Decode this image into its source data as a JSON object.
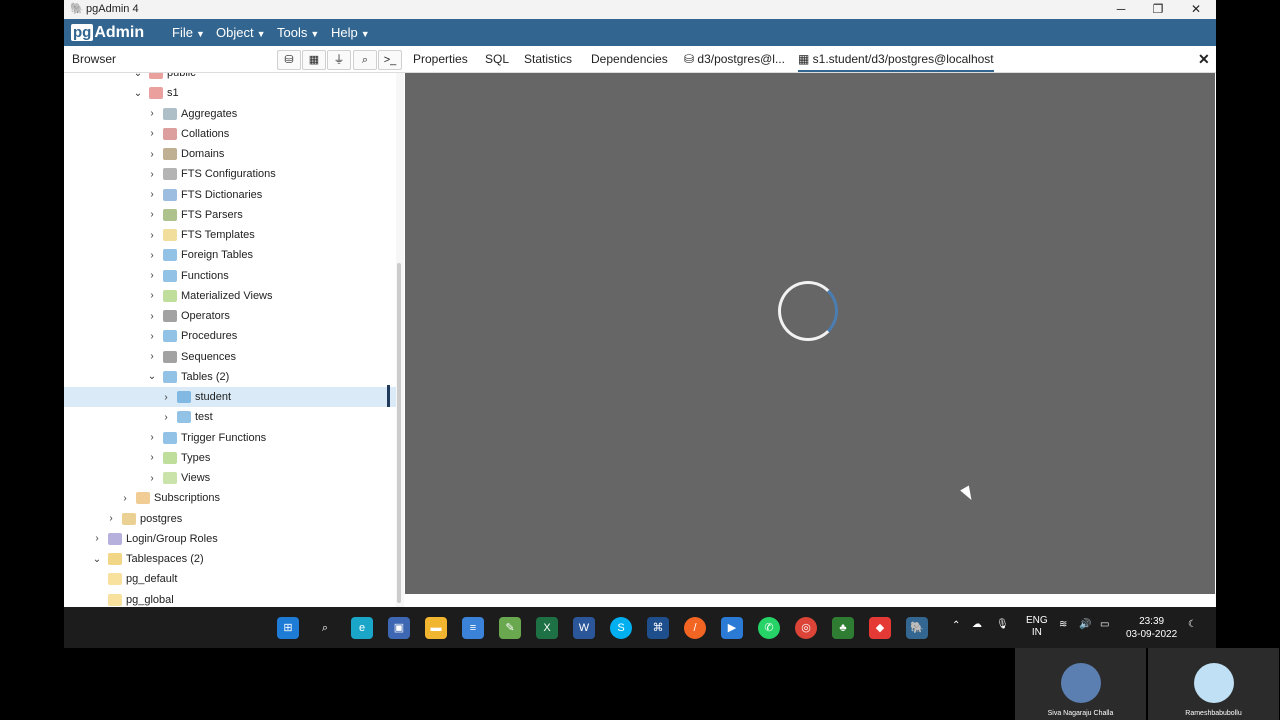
{
  "window": {
    "title": "pgAdmin 4",
    "controls": {
      "minimize": "─",
      "maximize": "❐",
      "close": "✕"
    }
  },
  "menubar": {
    "logo_pg": "pg",
    "logo_rest": "Admin",
    "items": [
      "File",
      "Object",
      "Tools",
      "Help"
    ]
  },
  "browser": {
    "label": "Browser",
    "toolbar_icons": [
      "database-icon",
      "table-icon",
      "filter-icon",
      "search-icon",
      "terminal-icon"
    ]
  },
  "tabs": {
    "items": [
      "Properties",
      "SQL",
      "Statistics",
      "Dependencies",
      "d3/postgres@l...",
      "s1.student/d3/postgres@localhost"
    ],
    "close": "✕"
  },
  "tree": [
    {
      "label": "public",
      "expanded": true,
      "icon": "schema-icon"
    },
    {
      "label": "s1",
      "expanded": true,
      "icon": "schema-icon"
    },
    {
      "label": "Aggregates",
      "icon": "aggregates-icon"
    },
    {
      "label": "Collations",
      "icon": "collations-icon"
    },
    {
      "label": "Domains",
      "icon": "domains-icon"
    },
    {
      "label": "FTS Configurations",
      "icon": "fts-config-icon"
    },
    {
      "label": "FTS Dictionaries",
      "icon": "fts-dict-icon"
    },
    {
      "label": "FTS Parsers",
      "icon": "fts-parser-icon"
    },
    {
      "label": "FTS Templates",
      "icon": "fts-template-icon"
    },
    {
      "label": "Foreign Tables",
      "icon": "foreign-table-icon"
    },
    {
      "label": "Functions",
      "icon": "function-icon"
    },
    {
      "label": "Materialized Views",
      "icon": "matview-icon"
    },
    {
      "label": "Operators",
      "icon": "operator-icon"
    },
    {
      "label": "Procedures",
      "icon": "procedure-icon"
    },
    {
      "label": "Sequences",
      "icon": "sequence-icon"
    },
    {
      "label": "Tables (2)",
      "expanded": true,
      "icon": "tables-icon"
    },
    {
      "label": "student",
      "selected": true,
      "icon": "table-icon"
    },
    {
      "label": "test",
      "icon": "table-icon"
    },
    {
      "label": "Trigger Functions",
      "icon": "trigger-function-icon"
    },
    {
      "label": "Types",
      "icon": "types-icon"
    },
    {
      "label": "Views",
      "icon": "views-icon"
    },
    {
      "label": "Subscriptions",
      "icon": "subscriptions-icon"
    },
    {
      "label": "postgres",
      "icon": "database-icon"
    },
    {
      "label": "Login/Group Roles",
      "icon": "roles-icon"
    },
    {
      "label": "Tablespaces (2)",
      "expanded": true,
      "icon": "tablespaces-icon"
    },
    {
      "label": "pg_default",
      "icon": "folder-icon"
    },
    {
      "label": "pg_global",
      "icon": "folder-icon"
    }
  ],
  "taskbar": {
    "lang_top": "ENG",
    "lang_bottom": "IN",
    "time": "23:39",
    "date": "03-09-2022"
  },
  "participants": [
    "Siva Nagaraju Challa",
    "Rameshbabubollu"
  ],
  "colors": {
    "accent": "#326690",
    "content_bg": "#666666",
    "selected_row": "#daeaf7"
  }
}
